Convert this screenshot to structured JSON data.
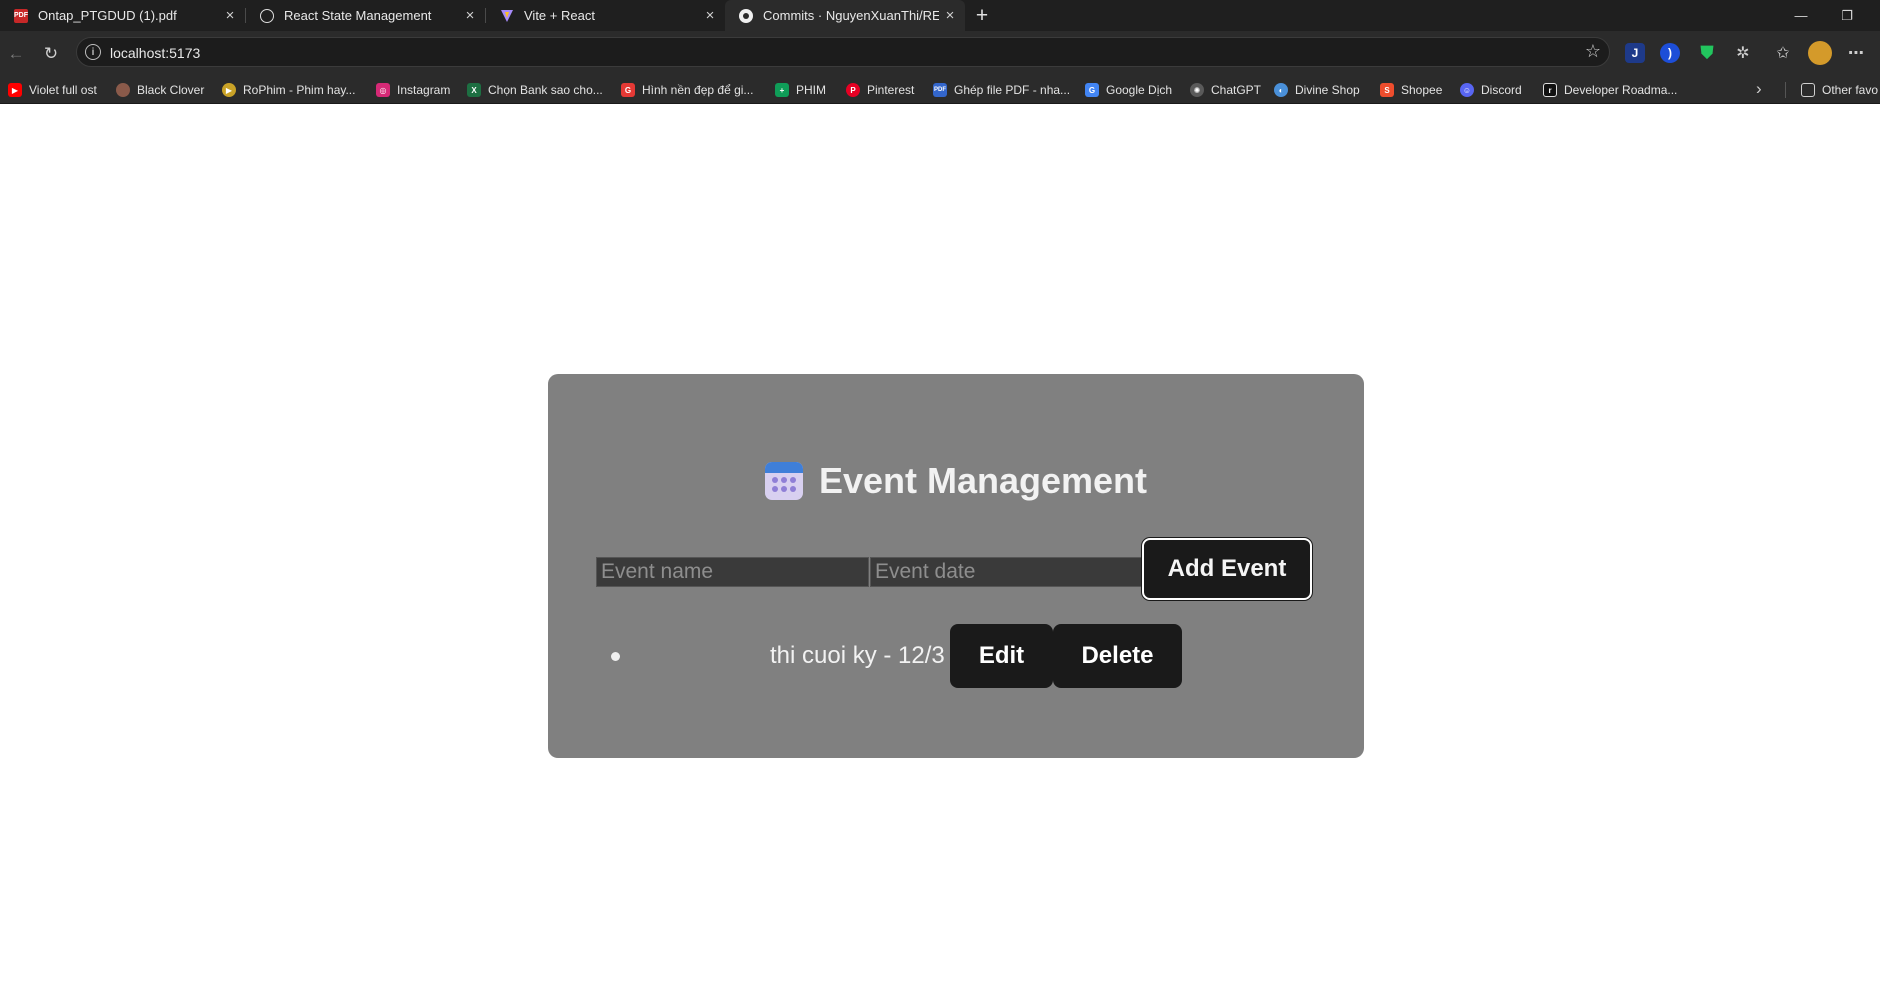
{
  "browser": {
    "tabs": [
      {
        "title": "Ontap_PTGDUD (1).pdf",
        "icon": "pdf-icon",
        "active": false
      },
      {
        "title": "React State Management",
        "icon": "chatgpt-icon",
        "active": false
      },
      {
        "title": "Vite + React",
        "icon": "vite-icon",
        "active": false
      },
      {
        "title": "Commits · NguyenXuanThi/REACT",
        "icon": "github-icon",
        "active": true
      }
    ],
    "url": "localhost:5173",
    "bookmarks": [
      {
        "label": "Violet full ost",
        "icon": "youtube-icon",
        "color": "#ff0000"
      },
      {
        "label": "Black Clover",
        "icon": "anime-icon",
        "color": "#8a5a4a"
      },
      {
        "label": "RoPhim - Phim hay...",
        "icon": "rophim-icon",
        "color": "#c9a227"
      },
      {
        "label": "Instagram",
        "icon": "instagram-icon",
        "color": "#d62976"
      },
      {
        "label": "Chọn Bank sao cho...",
        "icon": "excel-icon",
        "color": "#1d6f42"
      },
      {
        "label": "Hình nền đẹp để gi...",
        "icon": "g-icon",
        "color": "#e53935"
      },
      {
        "label": "PHIM",
        "icon": "sheets-icon",
        "color": "#0f9d58"
      },
      {
        "label": "Pinterest",
        "icon": "pinterest-icon",
        "color": "#e60023"
      },
      {
        "label": "Ghép file PDF - nha...",
        "icon": "pdf24-icon",
        "color": "#3366cc"
      },
      {
        "label": "Google Dịch",
        "icon": "translate-icon",
        "color": "#4285f4"
      },
      {
        "label": "ChatGPT",
        "icon": "chatgpt-icon",
        "color": "#5a5a5a"
      },
      {
        "label": "Divine Shop",
        "icon": "divine-icon",
        "color": "#4a90d9"
      },
      {
        "label": "Shopee",
        "icon": "shopee-icon",
        "color": "#ee4d2d"
      },
      {
        "label": "Discord",
        "icon": "discord-icon",
        "color": "#5865f2"
      },
      {
        "label": "Developer Roadma...",
        "icon": "roadmap-icon",
        "color": "#111111"
      }
    ],
    "other_favorites": "Other favo"
  },
  "app": {
    "title": "Event Management",
    "title_icon": "calendar-icon",
    "name_placeholder": "Event name",
    "date_placeholder": "Event date",
    "add_label": "Add Event",
    "events": [
      {
        "text": "thi cuoi ky - 12/3",
        "edit_label": "Edit",
        "delete_label": "Delete"
      }
    ]
  },
  "colors": {
    "card": "#808080",
    "button": "#1a1a1a",
    "chrome": "#2b2b2b"
  }
}
